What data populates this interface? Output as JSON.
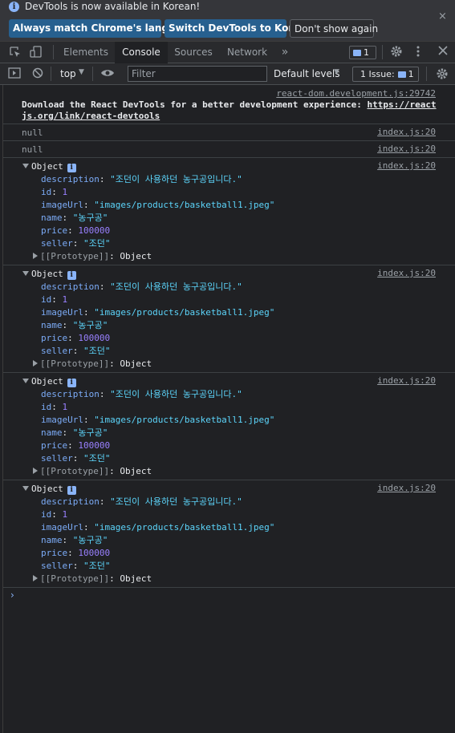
{
  "infobar": {
    "message": "DevTools is now available in Korean!",
    "btn_match": "Always match Chrome's language",
    "btn_switch": "Switch DevTools to Korean",
    "btn_dont": "Don't show again",
    "close": "×"
  },
  "tabs": {
    "elements": "Elements",
    "console": "Console",
    "sources": "Sources",
    "network": "Network",
    "more": "»",
    "msg_count": "1"
  },
  "toolbar": {
    "context": "top",
    "filter_placeholder": "Filter",
    "levels": "Default levels",
    "issues_label": "1 Issue:",
    "issues_count": "1"
  },
  "console": {
    "react_msg": {
      "source": "react-dom.development.js:29742",
      "text1": "Download the React DevTools for a better development experience: ",
      "link1": "https://react",
      "link2": "js.org/link/react-devtools"
    },
    "null_entries": [
      {
        "value": "null",
        "source": "index.js:20"
      },
      {
        "value": "null",
        "source": "index.js:20"
      }
    ],
    "objects": [
      {
        "label": "Object",
        "source": "index.js:20",
        "description": "\"조던이 사용하던 농구공입니다.\"",
        "id": "1",
        "imageUrl": "\"images/products/basketball1.jpeg\"",
        "name": "\"농구공\"",
        "price": "100000",
        "seller": "\"조던\"",
        "prototype": "[[Prototype]]",
        "prototype_value": "Object"
      },
      {
        "label": "Object",
        "source": "index.js:20",
        "description": "\"조던이 사용하던 농구공입니다.\"",
        "id": "1",
        "imageUrl": "\"images/products/basketball1.jpeg\"",
        "name": "\"농구공\"",
        "price": "100000",
        "seller": "\"조던\"",
        "prototype": "[[Prototype]]",
        "prototype_value": "Object"
      },
      {
        "label": "Object",
        "source": "index.js:20",
        "description": "\"조던이 사용하던 농구공입니다.\"",
        "id": "1",
        "imageUrl": "\"images/products/basketball1.jpeg\"",
        "name": "\"농구공\"",
        "price": "100000",
        "seller": "\"조던\"",
        "prototype": "[[Prototype]]",
        "prototype_value": "Object"
      },
      {
        "label": "Object",
        "source": "index.js:20",
        "description": "\"조던이 사용하던 농구공입니다.\"",
        "id": "1",
        "imageUrl": "\"images/products/basketball1.jpeg\"",
        "name": "\"농구공\"",
        "price": "100000",
        "seller": "\"조던\"",
        "prototype": "[[Prototype]]",
        "prototype_value": "Object"
      }
    ],
    "prompt": "›"
  }
}
